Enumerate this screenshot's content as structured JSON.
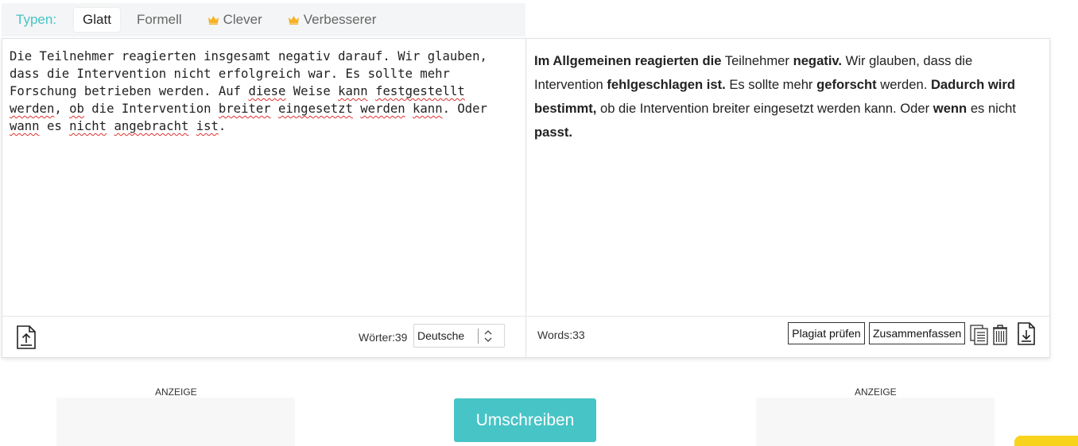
{
  "modes": {
    "label": "Typen:",
    "items": [
      "Glatt",
      "Formell",
      "Clever",
      "Verbesserer"
    ],
    "active": "Glatt",
    "premium_color": "#f5b225"
  },
  "input": {
    "segments": [
      {
        "t": "Die Teilnehmer reagierten insgesamt negativ darauf. Wir glauben, dass die Intervention nicht erfolgreich war. Es sollte mehr Forschung betrieben werden. Auf ",
        "s": false
      },
      {
        "t": "diese",
        "s": true
      },
      {
        "t": " Weise ",
        "s": false
      },
      {
        "t": "kann",
        "s": true
      },
      {
        "t": " ",
        "s": false
      },
      {
        "t": "festgestellt",
        "s": true
      },
      {
        "t": " ",
        "s": false
      },
      {
        "t": "werden",
        "s": true
      },
      {
        "t": ", ",
        "s": false
      },
      {
        "t": "ob",
        "s": true
      },
      {
        "t": " die Intervention ",
        "s": false
      },
      {
        "t": "breiter",
        "s": true
      },
      {
        "t": " ",
        "s": false
      },
      {
        "t": "eingesetzt",
        "s": true
      },
      {
        "t": " ",
        "s": false
      },
      {
        "t": "werden",
        "s": true
      },
      {
        "t": " ",
        "s": false
      },
      {
        "t": "kann",
        "s": true
      },
      {
        "t": ". Oder ",
        "s": false
      },
      {
        "t": "wann",
        "s": true
      },
      {
        "t": " es ",
        "s": false
      },
      {
        "t": "nicht",
        "s": true
      },
      {
        "t": " ",
        "s": false
      },
      {
        "t": "angebracht",
        "s": true
      },
      {
        "t": " ",
        "s": false
      },
      {
        "t": "ist",
        "s": true
      },
      {
        "t": ".",
        "s": false
      }
    ],
    "word_count_label": "Wörter:39",
    "language": "Deutsche"
  },
  "output": {
    "segments": [
      {
        "t": "Im Allgemeinen reagierten die",
        "b": true
      },
      {
        "t": " Teilnehmer ",
        "b": false
      },
      {
        "t": "negativ.",
        "b": true
      },
      {
        "t": " Wir glauben, dass die Intervention ",
        "b": false
      },
      {
        "t": "fehlgeschlagen ist.",
        "b": true
      },
      {
        "t": " Es sollte mehr ",
        "b": false
      },
      {
        "t": "geforscht",
        "b": true
      },
      {
        "t": " werden. ",
        "b": false
      },
      {
        "t": "Dadurch wird bestimmt,",
        "b": true
      },
      {
        "t": " ob die Intervention breiter eingesetzt werden kann. Oder ",
        "b": false
      },
      {
        "t": "wenn",
        "b": true
      },
      {
        "t": " es nicht ",
        "b": false
      },
      {
        "t": "passt.",
        "b": true
      }
    ],
    "word_count_label": "Words:33",
    "plagiarism_label": "Plagiat prüfen",
    "summarize_label": "Zusammenfassen"
  },
  "ads": {
    "left_label": "ANZEIGE",
    "right_label": "ANZEIGE"
  },
  "rewrite_label": "Umschreiben",
  "colors": {
    "accent": "#47c4c6",
    "spell_error": "#e03030",
    "yellow_widget": "#f7d31b"
  }
}
